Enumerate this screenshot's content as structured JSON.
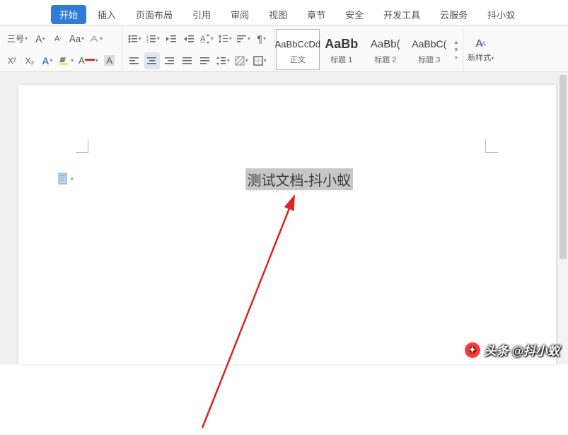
{
  "tabs": {
    "items": [
      "开始",
      "插入",
      "页面布局",
      "引用",
      "审阅",
      "视图",
      "章节",
      "安全",
      "开发工具",
      "云服务",
      "抖小蚁"
    ],
    "active_index": 0
  },
  "ribbon": {
    "font_size_label": "三号",
    "styles": [
      {
        "preview": "AaBbCcDd",
        "label": "正文",
        "big": false,
        "sel": true
      },
      {
        "preview": "AaBb",
        "label": "标题 1",
        "big": true,
        "sel": false
      },
      {
        "preview": "AaBb(",
        "label": "标题 2",
        "big": false,
        "sel": false
      },
      {
        "preview": "AaBbC(",
        "label": "标题 3",
        "big": false,
        "sel": false
      }
    ],
    "new_style_label": "新样式"
  },
  "document": {
    "selected_text": "测试文档-抖小蚁"
  },
  "watermark": {
    "text": "头条 @抖小蚁"
  }
}
